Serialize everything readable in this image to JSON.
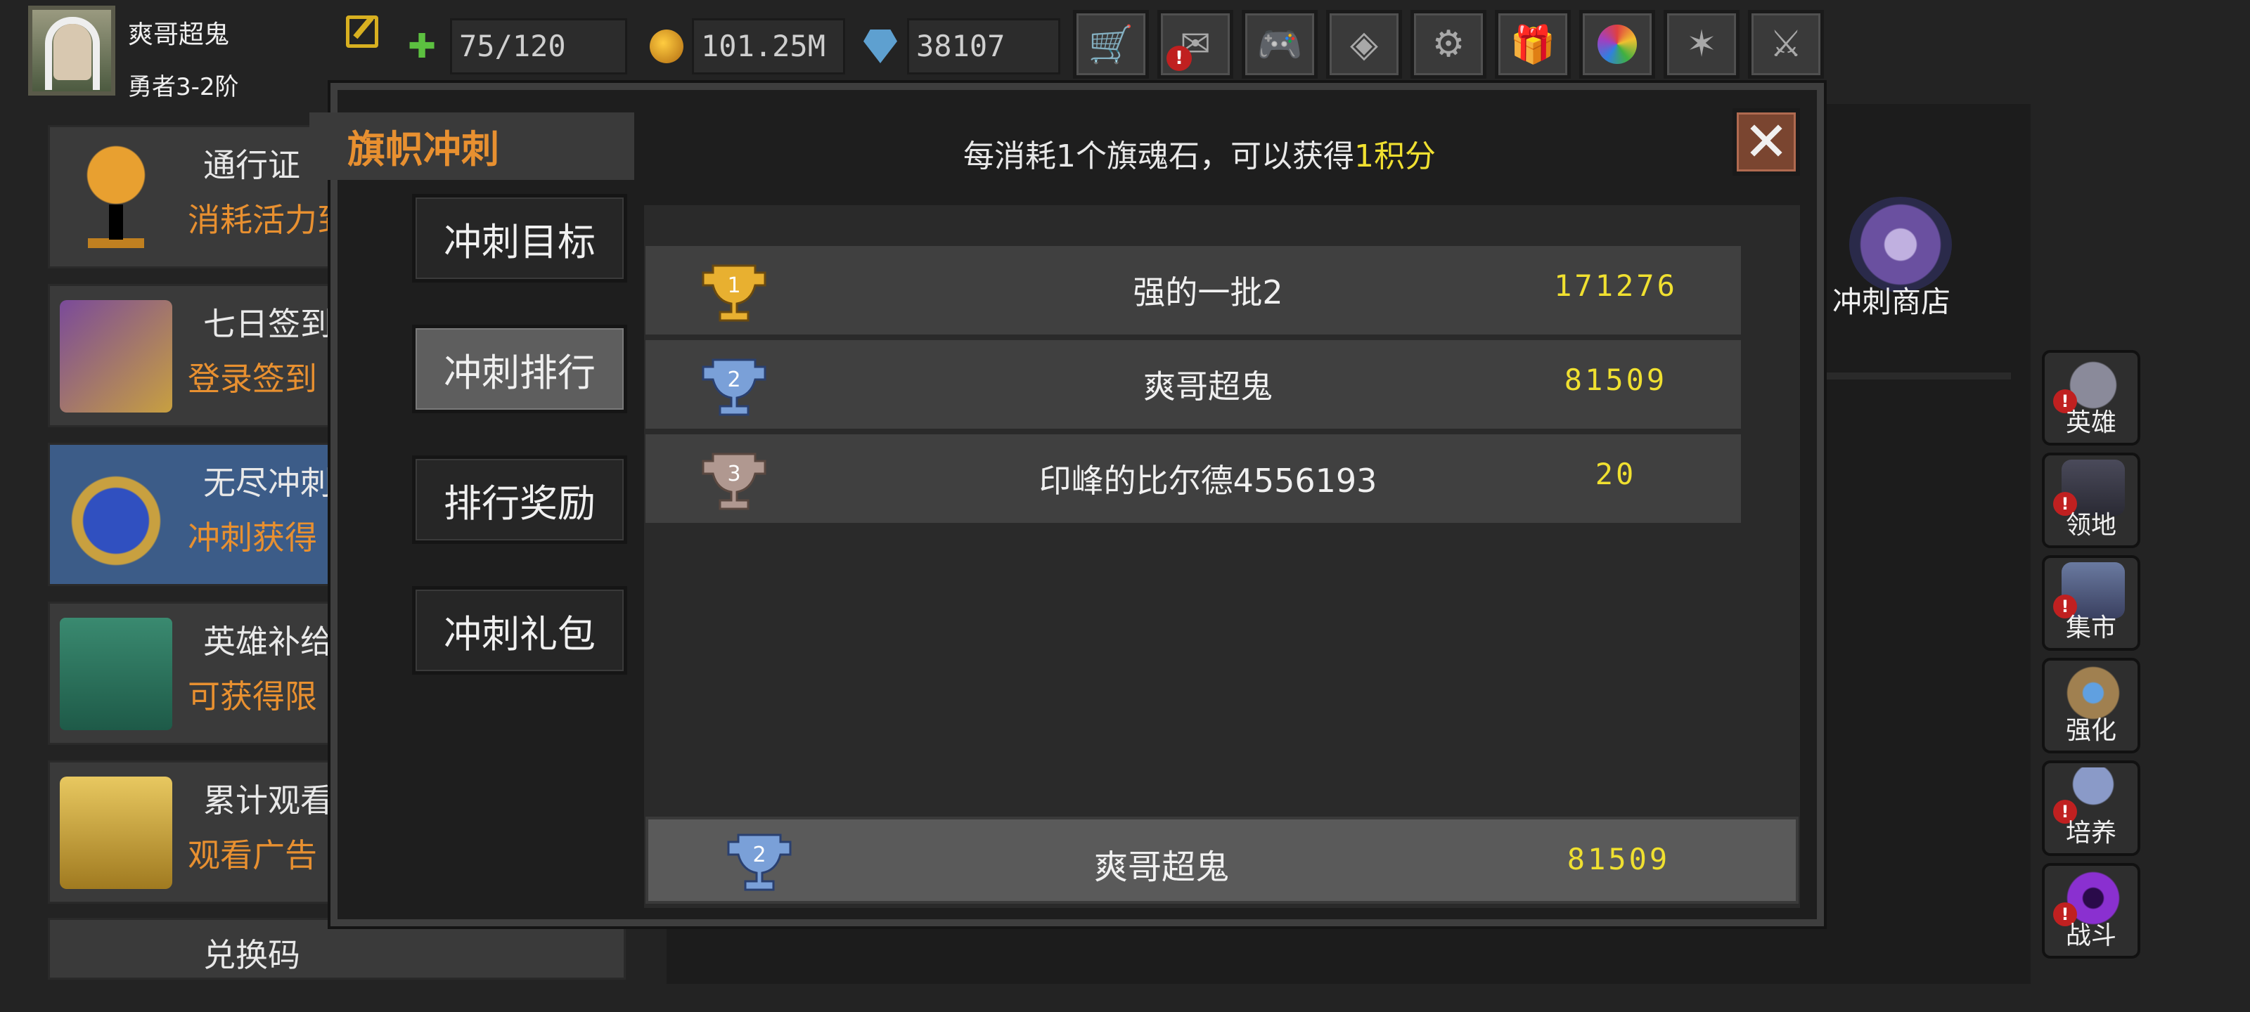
{
  "player": {
    "name": "爽哥超鬼",
    "rank": "勇者3-2阶"
  },
  "resources": {
    "energy": "75/120",
    "gold": "101.25M",
    "gems": "38107"
  },
  "toolbar": [
    {
      "icon": "cart-icon",
      "warn": false
    },
    {
      "icon": "mail-icon",
      "warn": true
    },
    {
      "icon": "gamepad-icon",
      "warn": false
    },
    {
      "icon": "guild-icon",
      "warn": false
    },
    {
      "icon": "gear-icon",
      "warn": false
    },
    {
      "icon": "gift-icon",
      "warn": false
    },
    {
      "icon": "color-wheel-icon",
      "warn": false
    },
    {
      "icon": "firework-icon",
      "warn": false
    },
    {
      "icon": "crossed-swords-icon",
      "warn": false
    }
  ],
  "events": [
    {
      "title": "通行证",
      "subtitle": "消耗活力到"
    },
    {
      "title": "七日签到",
      "subtitle": "登录签到"
    },
    {
      "title": "无尽冲刺",
      "subtitle": "冲刺获得"
    },
    {
      "title": "英雄补给",
      "subtitle": "可获得限"
    },
    {
      "title": "累计观看",
      "subtitle": "观看广告"
    },
    {
      "title": "兑换码",
      "subtitle": ""
    }
  ],
  "shop_label": "冲刺商店",
  "side_menu": [
    {
      "label": "英雄",
      "warn": true
    },
    {
      "label": "领地",
      "warn": true
    },
    {
      "label": "集市",
      "warn": true
    },
    {
      "label": "强化",
      "warn": false
    },
    {
      "label": "培养",
      "warn": true
    },
    {
      "label": "战斗",
      "warn": true
    }
  ],
  "modal": {
    "title": "旗帜冲刺",
    "tip_prefix": "每消耗1个旗魂石，可以获得",
    "tip_highlight": "1积分",
    "tabs": [
      "冲刺目标",
      "冲刺排行",
      "排行奖励",
      "冲刺礼包"
    ],
    "active_tab": 1,
    "ranking": [
      {
        "rank": "1",
        "name": "强的一批2",
        "score": "171276"
      },
      {
        "rank": "2",
        "name": "爽哥超鬼",
        "score": "81509"
      },
      {
        "rank": "3",
        "name": "印峰的比尔德4556193",
        "score": "20"
      }
    ],
    "my_rank": {
      "rank": "2",
      "name": "爽哥超鬼",
      "score": "81509"
    }
  },
  "colors": {
    "accent_orange": "#e89030",
    "score_yellow": "#f0e030",
    "gold_trophy": "#e8b030",
    "silver_trophy": "#7aa0d8",
    "bronze_trophy": "#b09890"
  }
}
